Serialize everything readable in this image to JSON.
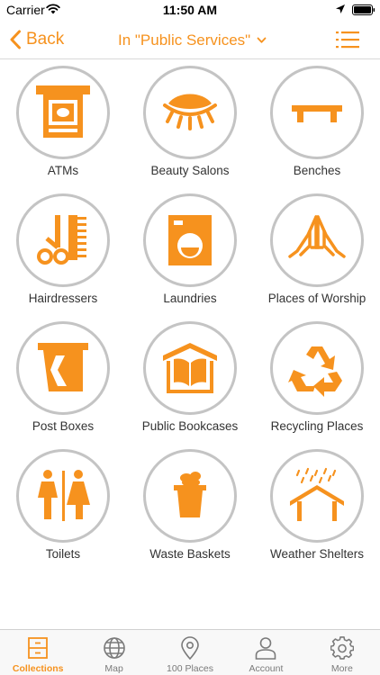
{
  "status_bar": {
    "carrier": "Carrier",
    "time": "11:50 AM"
  },
  "nav_bar": {
    "back_label": "Back",
    "title": "In \"Public Services\""
  },
  "colors": {
    "accent": "#f6921e",
    "circle_border": "#c4c4c4",
    "tab_inactive": "#7a7a7a"
  },
  "categories": [
    {
      "label": "ATMs",
      "icon": "atm-icon"
    },
    {
      "label": "Beauty Salons",
      "icon": "beauty-salon-icon"
    },
    {
      "label": "Benches",
      "icon": "bench-icon"
    },
    {
      "label": "Hairdressers",
      "icon": "hairdresser-icon"
    },
    {
      "label": "Laundries",
      "icon": "laundry-icon"
    },
    {
      "label": "Places of Worship",
      "icon": "praying-hands-icon"
    },
    {
      "label": "Post Boxes",
      "icon": "post-box-icon"
    },
    {
      "label": "Public Bookcases",
      "icon": "public-bookcase-icon"
    },
    {
      "label": "Recycling Places",
      "icon": "recycling-icon"
    },
    {
      "label": "Toilets",
      "icon": "toilets-icon"
    },
    {
      "label": "Waste Baskets",
      "icon": "waste-basket-icon"
    },
    {
      "label": "Weather Shelters",
      "icon": "weather-shelter-icon"
    }
  ],
  "tab_bar": {
    "tabs": [
      {
        "label": "Collections",
        "icon": "collections-icon",
        "active": true
      },
      {
        "label": "Map",
        "icon": "globe-icon",
        "active": false
      },
      {
        "label": "100 Places",
        "icon": "location-pin-icon",
        "active": false
      },
      {
        "label": "Account",
        "icon": "person-icon",
        "active": false
      },
      {
        "label": "More",
        "icon": "gear-icon",
        "active": false
      }
    ]
  }
}
